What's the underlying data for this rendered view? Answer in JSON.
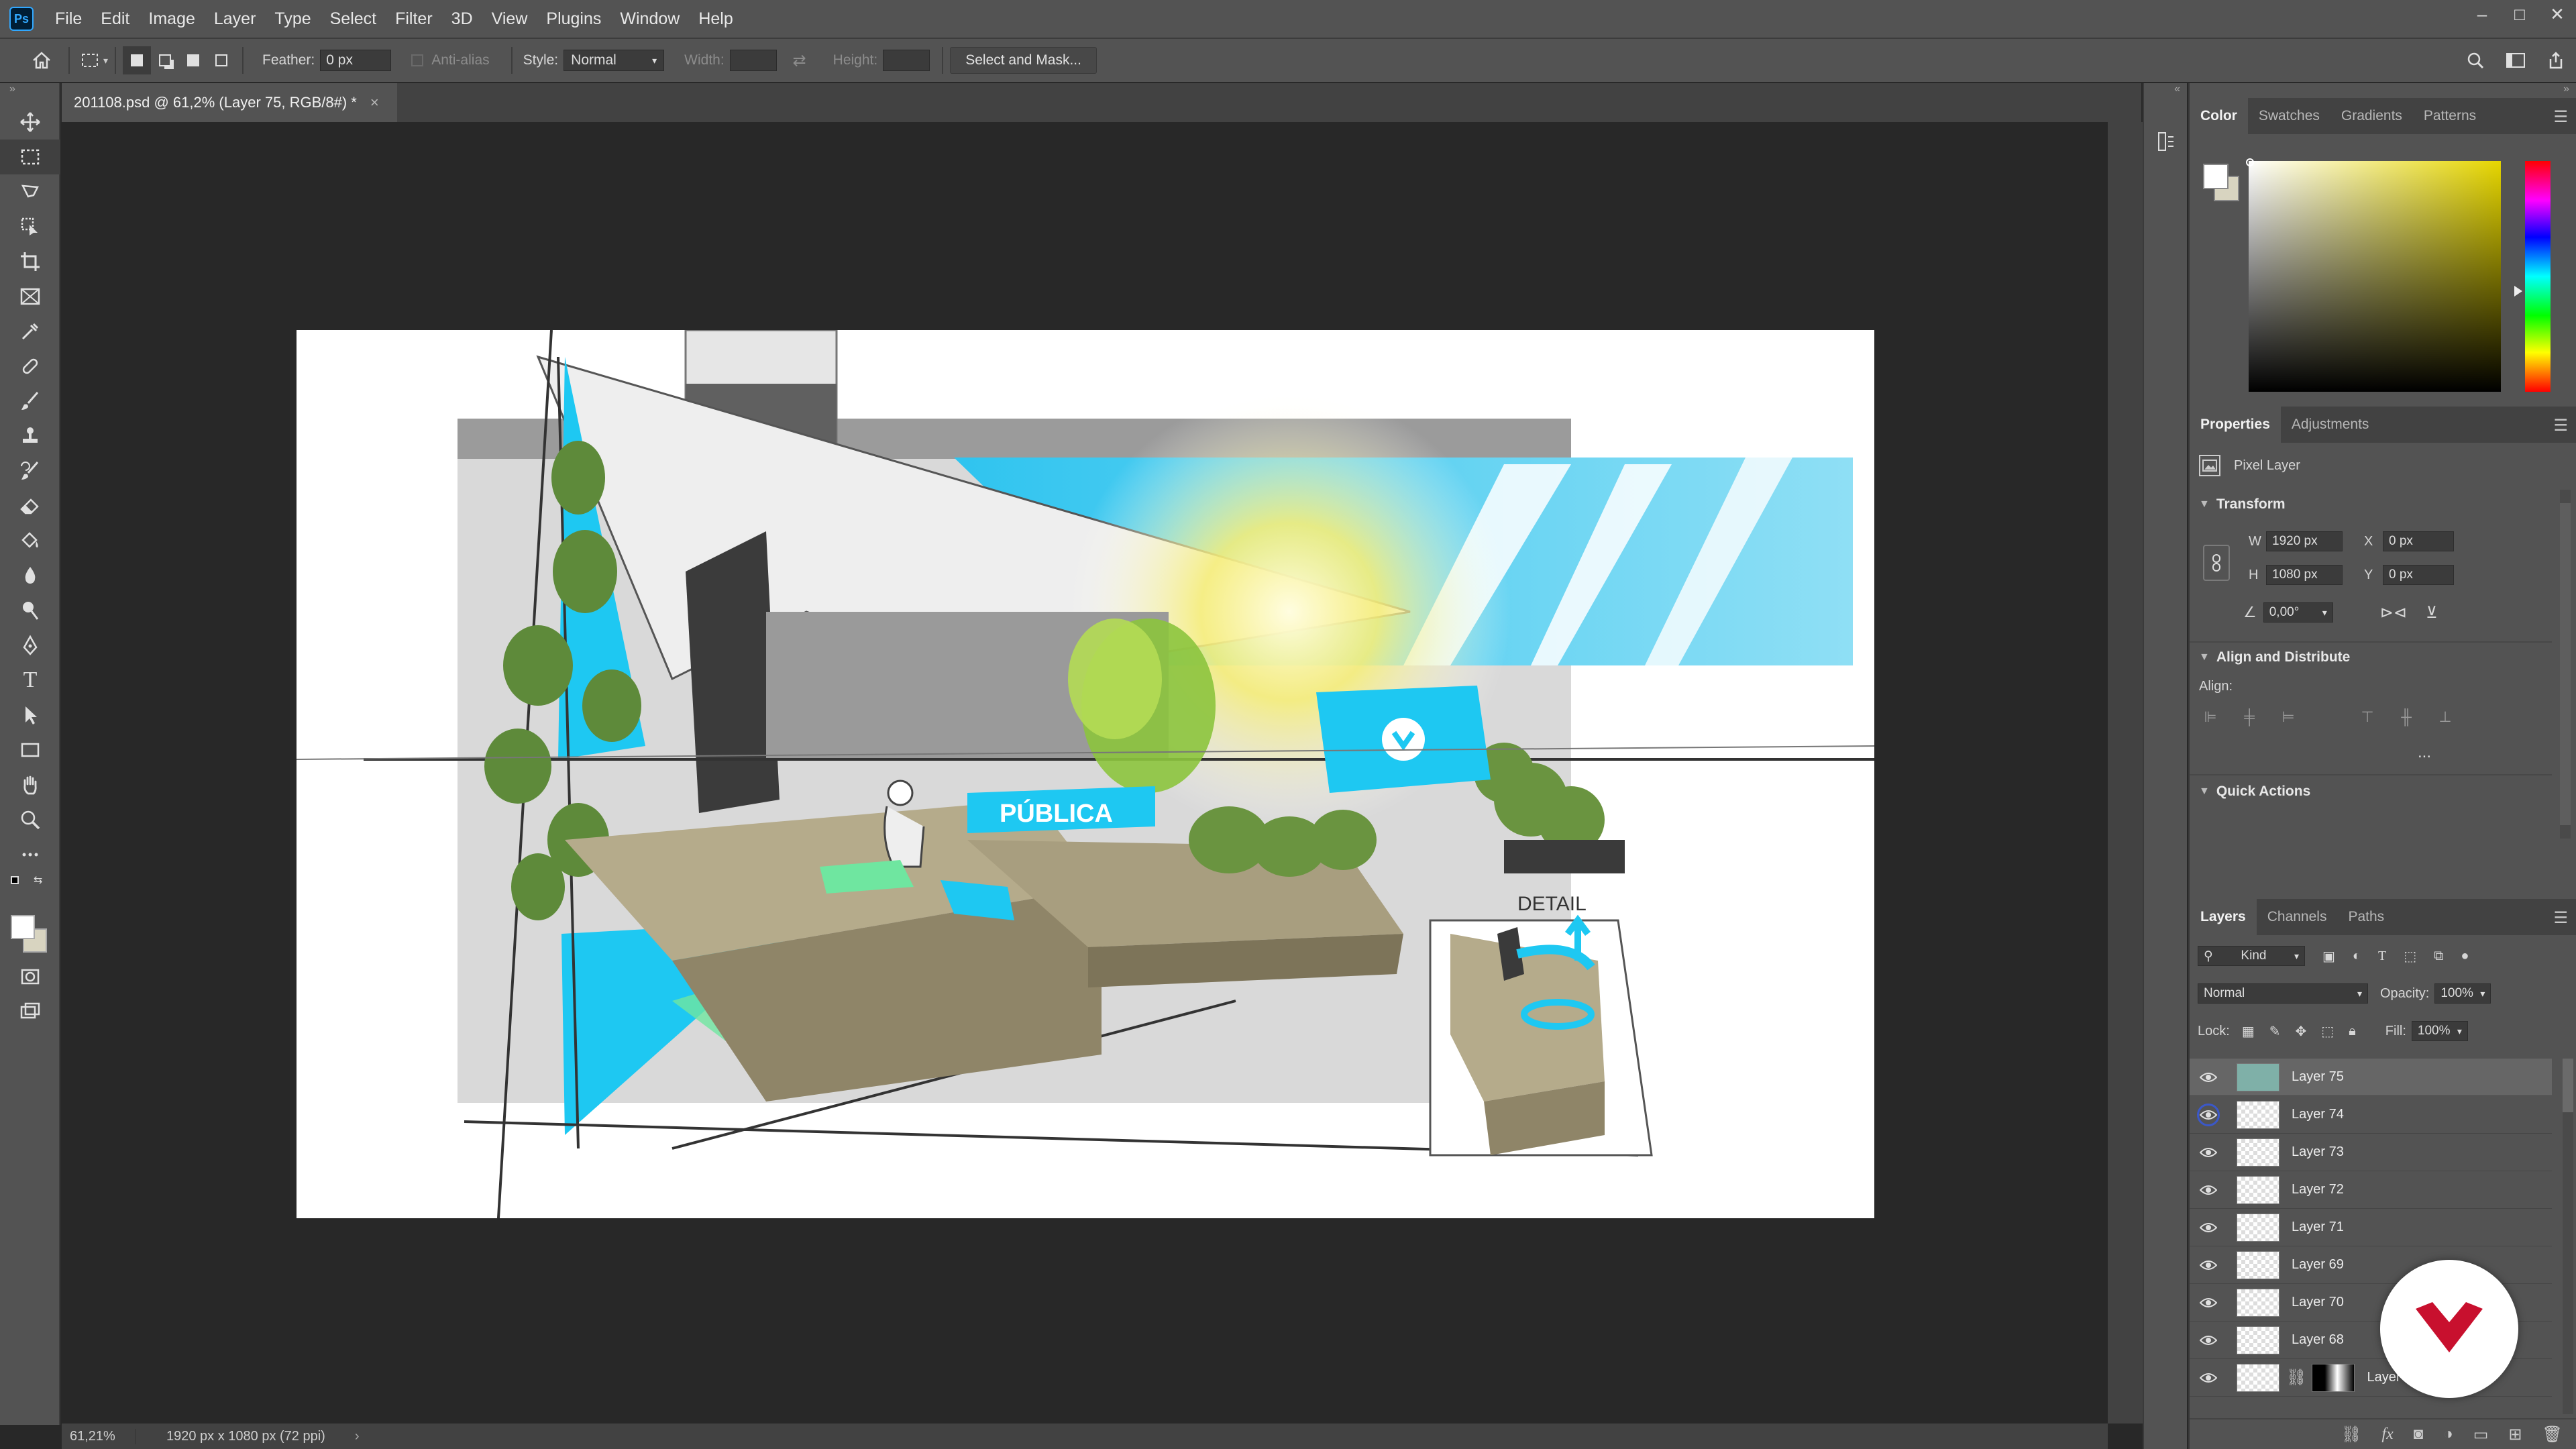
{
  "app": {
    "logo_text": "Ps"
  },
  "menu": {
    "items": [
      "File",
      "Edit",
      "Image",
      "Layer",
      "Type",
      "Select",
      "Filter",
      "3D",
      "View",
      "Plugins",
      "Window",
      "Help"
    ]
  },
  "window_controls": {
    "minimize": "–",
    "maximize": "□",
    "close": "✕"
  },
  "options": {
    "feather_label": "Feather:",
    "feather_value": "0 px",
    "antialias_label": "Anti-alias",
    "style_label": "Style:",
    "style_value": "Normal",
    "width_label": "Width:",
    "height_label": "Height:",
    "select_mask_label": "Select and Mask..."
  },
  "document": {
    "tab_title": "201108.psd @ 61,2% (Layer 75, RGB/8#) *",
    "close": "×"
  },
  "status": {
    "zoom": "61,21%",
    "doc_size": "1920 px x 1080 px (72 ppi)",
    "arrow": "›"
  },
  "artwork": {
    "sign_text": "PÚBLICA",
    "detail_text": "DETAIL"
  },
  "color_panel": {
    "tabs": [
      "Color",
      "Swatches",
      "Gradients",
      "Patterns"
    ],
    "foreground": "#ffffff",
    "background": "#d8d4c0"
  },
  "properties_panel": {
    "tabs": [
      "Properties",
      "Adjustments"
    ],
    "layer_kind": "Pixel Layer",
    "transform_title": "Transform",
    "w_label": "W",
    "w_value": "1920 px",
    "h_label": "H",
    "h_value": "1080 px",
    "x_label": "X",
    "x_value": "0 px",
    "y_label": "Y",
    "y_value": "0 px",
    "angle_value": "0,00°",
    "align_title": "Align and Distribute",
    "align_label": "Align:",
    "more": "...",
    "quick_actions_title": "Quick Actions"
  },
  "layers_panel": {
    "tabs": [
      "Layers",
      "Channels",
      "Paths"
    ],
    "filter_label": "Kind",
    "blend_mode": "Normal",
    "opacity_label": "Opacity:",
    "opacity_value": "100%",
    "lock_label": "Lock:",
    "fill_label": "Fill:",
    "fill_value": "100%",
    "layers": [
      {
        "name": "Layer 75",
        "selected": true
      },
      {
        "name": "Layer 74",
        "selected": false
      },
      {
        "name": "Layer 73",
        "selected": false
      },
      {
        "name": "Layer 72",
        "selected": false
      },
      {
        "name": "Layer 71",
        "selected": false
      },
      {
        "name": "Layer 69",
        "selected": false
      },
      {
        "name": "Layer 70",
        "selected": false
      },
      {
        "name": "Layer 68",
        "selected": false
      },
      {
        "name": "Layer 67",
        "selected": false
      }
    ]
  },
  "colors": {
    "accent_blue": "#31a8ff",
    "badge_red": "#c8102e",
    "sketch_cyan": "#1ec8f2"
  }
}
